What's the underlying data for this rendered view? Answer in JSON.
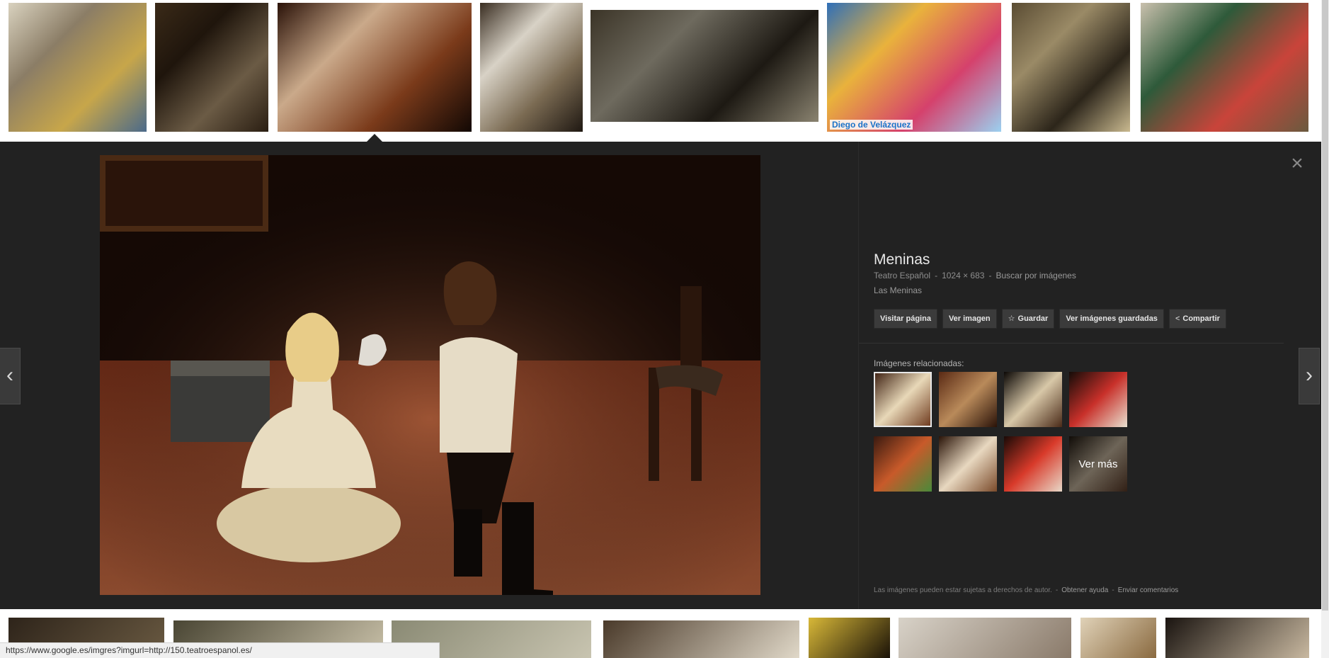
{
  "top_strip": {
    "thumbs": [
      {
        "name": "cartoon-meninas",
        "colors": [
          "#d9d2bf",
          "#8b7d66",
          "#c7a64a",
          "#4b6a8a"
        ]
      },
      {
        "name": "mirror-painting",
        "colors": [
          "#3a2a18",
          "#1f150c",
          "#6b5b45",
          "#2a1e12"
        ]
      },
      {
        "name": "stage-meninas-selected",
        "colors": [
          "#2a1208",
          "#caa98a",
          "#7a3a1a",
          "#120804"
        ]
      },
      {
        "name": "collage-meninas",
        "colors": [
          "#3a2e22",
          "#d8d2c6",
          "#7a6a52",
          "#1f1812"
        ]
      },
      {
        "name": "velazquez-portrait",
        "colors": [
          "#3b3427",
          "#6e6a5e",
          "#1d1913",
          "#8a8370"
        ]
      },
      {
        "name": "toy-meninas",
        "colors": [
          "#2f6fb8",
          "#e9b23c",
          "#d5416c",
          "#9bd0f0"
        ]
      },
      {
        "name": "painting-room",
        "colors": [
          "#5a4c33",
          "#9a8a66",
          "#2c251a",
          "#c9b98f"
        ]
      },
      {
        "name": "mural-meninas",
        "colors": [
          "#c9c0ad",
          "#2e5a3a",
          "#c9443a",
          "#6a5a3f"
        ]
      }
    ],
    "caption_on_toy": "Diego de Velázquez"
  },
  "viewer": {
    "title": "Meninas",
    "source": "Teatro Español",
    "dimensions": "1024 × 683",
    "search_by_image": "Buscar por imágenes",
    "subtitle": "Las Meninas",
    "actions": {
      "visit_page": "Visitar página",
      "view_image": "Ver imagen",
      "save": "Guardar",
      "saved_images": "Ver imágenes guardadas",
      "share": "Compartir"
    },
    "related_label": "Imágenes relacionadas:",
    "related_more": "Ver más",
    "related": [
      {
        "colors": [
          "#3a1c0e",
          "#e8d8b8",
          "#6a3418"
        ]
      },
      {
        "colors": [
          "#5a2a14",
          "#b98a5a",
          "#2a1208"
        ]
      },
      {
        "colors": [
          "#0c0806",
          "#d8c8a8",
          "#4a2a18"
        ]
      },
      {
        "colors": [
          "#140c08",
          "#c8302a",
          "#e8e0d0"
        ]
      },
      {
        "colors": [
          "#3a1a10",
          "#c85a2a",
          "#4a8a3a"
        ]
      },
      {
        "colors": [
          "#2a1408",
          "#e8d8c0",
          "#7a4a2a"
        ]
      },
      {
        "colors": [
          "#1a0a06",
          "#d83a2a",
          "#e8d8c8"
        ]
      },
      {
        "colors": [
          "#201810",
          "#c8b8a0",
          "#5a3a28"
        ]
      }
    ],
    "footer": {
      "copyright": "Las imágenes pueden estar sujetas a derechos de autor.",
      "help": "Obtener ayuda",
      "feedback": "Enviar comentarios"
    }
  },
  "bottom_strip": {
    "thumbs": [
      {
        "colors": [
          "#2e241a",
          "#6a5a42"
        ]
      },
      {
        "colors": [
          "#4a4634",
          "#c8c0a8"
        ]
      },
      {
        "colors": [
          "#8a8a74",
          "#c8c4b0"
        ]
      },
      {
        "colors": [
          "#4a3a2a",
          "#e0d8c8"
        ]
      },
      {
        "colors": [
          "#d8b838",
          "#1a1208"
        ]
      },
      {
        "colors": [
          "#d8d2c8",
          "#8a7a6a"
        ]
      },
      {
        "colors": [
          "#e0d2b8",
          "#8a6a40"
        ]
      },
      {
        "colors": [
          "#1a1410",
          "#c8b8a0"
        ]
      }
    ]
  },
  "status_bar": {
    "url": "https://www.google.es/imgres?imgurl=http://150.teatroespanol.es/"
  }
}
